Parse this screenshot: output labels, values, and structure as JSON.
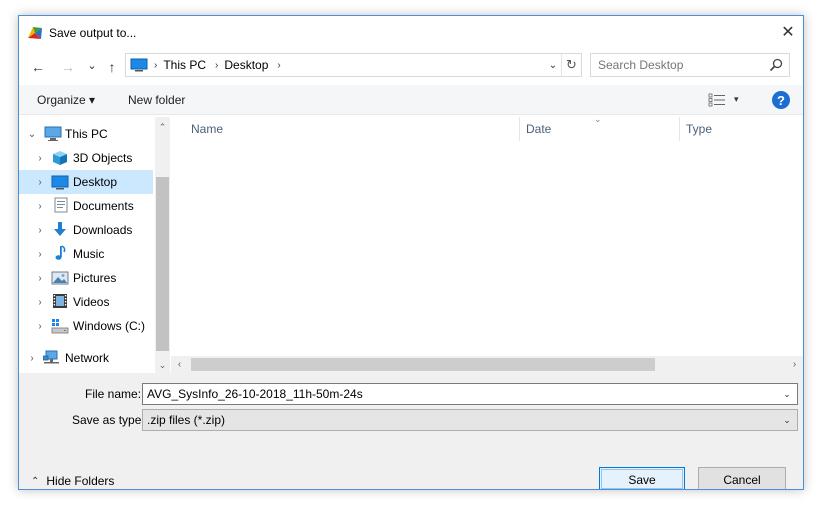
{
  "window": {
    "title": "Save output to...",
    "close_glyph": "✕"
  },
  "nav": {
    "back_glyph": "←",
    "forward_glyph": "→",
    "recent_glyph": "⌄",
    "up_glyph": "↑",
    "breadcrumbs": [
      "This PC",
      "Desktop"
    ],
    "crumb_separator": "›",
    "dropdown_glyph": "⌄",
    "refresh_glyph": "↻",
    "search_placeholder": "Search Desktop"
  },
  "toolbar": {
    "organize_label": "Organize ▾",
    "new_folder_label": "New folder",
    "view_dropdown_glyph": "▾",
    "help_label": "?"
  },
  "tree": {
    "root": {
      "label": "This PC",
      "chevron": "⌄",
      "icon": "computer-icon"
    },
    "items": [
      {
        "label": "3D Objects",
        "icon": "cube-icon"
      },
      {
        "label": "Desktop",
        "icon": "desktop-icon",
        "selected": true
      },
      {
        "label": "Documents",
        "icon": "document-icon"
      },
      {
        "label": "Downloads",
        "icon": "download-icon"
      },
      {
        "label": "Music",
        "icon": "music-note-icon"
      },
      {
        "label": "Pictures",
        "icon": "picture-icon"
      },
      {
        "label": "Videos",
        "icon": "film-icon"
      },
      {
        "label": "Windows (C:)",
        "icon": "drive-icon"
      }
    ],
    "network": {
      "label": "Network",
      "icon": "network-icon"
    },
    "item_chevron": "›"
  },
  "filelist": {
    "columns": [
      "Name",
      "Date",
      "Type"
    ],
    "sort_glyph": "⌄",
    "scroll_left": "‹",
    "scroll_right": "›"
  },
  "form": {
    "filename_label": "File name:",
    "filename_value": "AVG_SysInfo_26-10-2018_11h-50m-24s",
    "type_label": "Save as type:",
    "type_value": ".zip files (*.zip)",
    "dropdown_glyph": "⌄"
  },
  "footer": {
    "hide_folders_chevron": "⌃",
    "hide_folders_label": "Hide Folders",
    "save_label": "Save",
    "cancel_label": "Cancel"
  },
  "colors": {
    "selection": "#cce8ff",
    "accent": "#0078d7",
    "help": "#1a6fd1"
  }
}
